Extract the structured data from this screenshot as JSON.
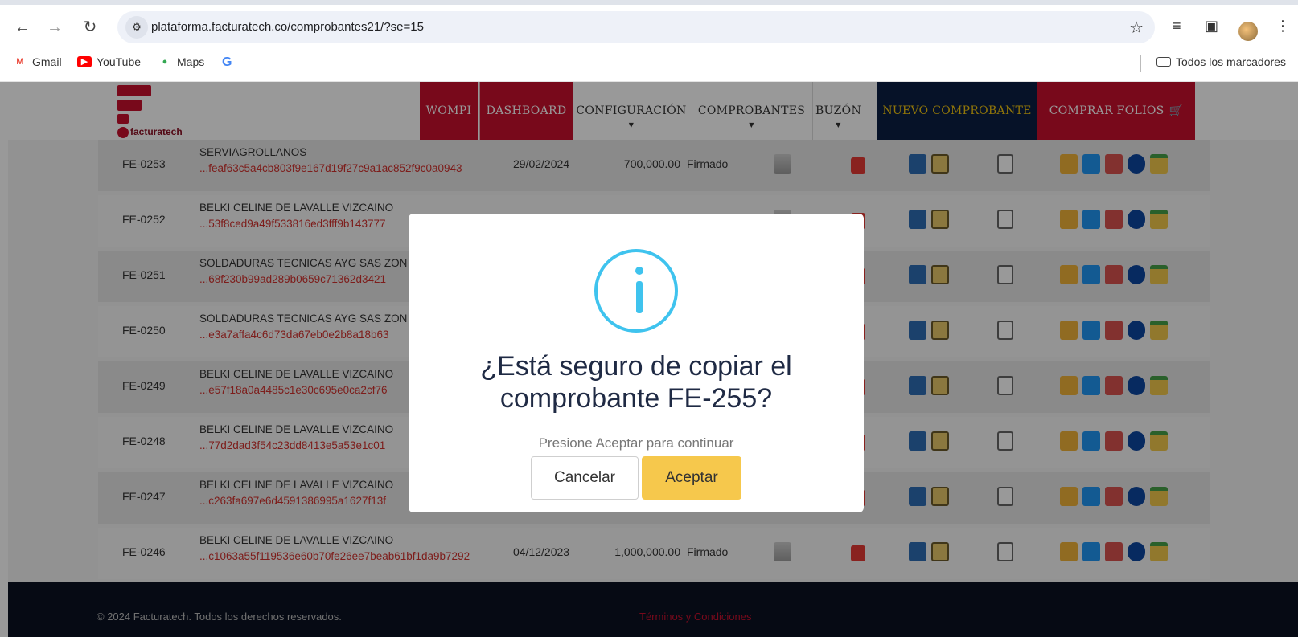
{
  "browser": {
    "url": "plataforma.facturatech.co/comprobantes21/?se=15",
    "bookmarks": [
      "Gmail",
      "YouTube",
      "Maps",
      "G"
    ],
    "all_bookmarks_label": "Todos los marcadores"
  },
  "header": {
    "logo_text": "facturatech",
    "menu": [
      "WOMPI",
      "DASHBOARD",
      "CONFIGURACIÓN",
      "COMPROBANTES",
      "BUZÓN",
      "NUEVO COMPROBANTE",
      "COMPRAR FOLIOS"
    ]
  },
  "rows": [
    {
      "code": "FE-0253",
      "client": "SERVIAGROLLANOS",
      "hash": "...feaf63c5a4cb803f9e167d19f27c9a1ac852f9c0a0943",
      "date": "29/02/2024",
      "value": "700,000.00",
      "status": "Firmado"
    },
    {
      "code": "FE-0252",
      "client": "BELKI CELINE DE LAVALLE VIZCAINO",
      "hash": "...53f8ced9a49f533816ed3fff9b143777",
      "date": "",
      "value": "",
      "status": ""
    },
    {
      "code": "FE-0251",
      "client": "SOLDADURAS TECNICAS AYG SAS ZON",
      "hash": "...68f230b99ad289b0659c71362d3421",
      "date": "",
      "value": "",
      "status": ""
    },
    {
      "code": "FE-0250",
      "client": "SOLDADURAS TECNICAS AYG SAS ZON",
      "hash": "...e3a7affa4c6d73da67eb0e2b8a18b63",
      "date": "",
      "value": "",
      "status": ""
    },
    {
      "code": "FE-0249",
      "client": "BELKI CELINE DE LAVALLE VIZCAINO",
      "hash": "...e57f18a0a4485c1e30c695e0ca2cf76",
      "date": "",
      "value": "",
      "status": ""
    },
    {
      "code": "FE-0248",
      "client": "BELKI CELINE DE LAVALLE VIZCAINO",
      "hash": "...77d2dad3f54c23dd8413e5a53e1c01",
      "date": "",
      "value": "",
      "status": ""
    },
    {
      "code": "FE-0247",
      "client": "BELKI CELINE DE LAVALLE VIZCAINO",
      "hash": "...c263fa697e6d4591386995a1627f13f",
      "date": "",
      "value": "",
      "status": ""
    },
    {
      "code": "FE-0246",
      "client": "BELKI CELINE DE LAVALLE VIZCAINO",
      "hash": "...c1063a55f119536e60b70fe26ee7beab61bf1da9b7292",
      "date": "04/12/2023",
      "value": "1,000,000.00",
      "status": "Firmado"
    }
  ],
  "footer": {
    "copyright": "© 2024 Facturatech. Todos los derechos reservados.",
    "terms": "Términos y Condiciones"
  },
  "modal": {
    "title": "¿Está seguro de copiar el comprobante FE-255?",
    "text": "Presione Aceptar para continuar",
    "cancel_label": "Cancelar",
    "accept_label": "Aceptar"
  },
  "colors": {
    "brand": "#c8102e",
    "navy": "#0a1f44",
    "info": "#3fc3ee",
    "accept": "#f6c84c"
  }
}
